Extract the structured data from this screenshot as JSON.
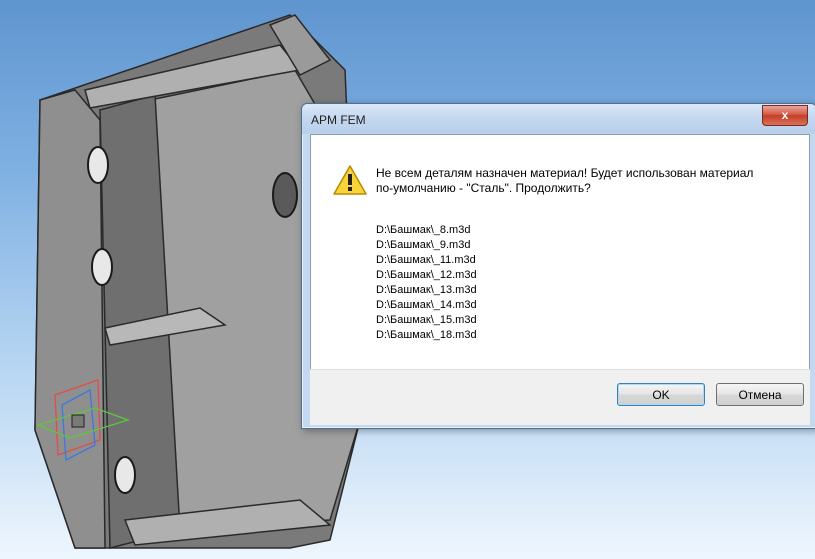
{
  "dialog": {
    "title": "APM FEM",
    "close_label": "x",
    "message_line1": "Не всем деталям назначен материал! Будет использован материал",
    "message_line2": "по-умолчанию - \"Сталь\". Продолжить?",
    "files": [
      "D:\\Башмак\\_8.m3d",
      "D:\\Башмак\\_9.m3d",
      "D:\\Башмак\\_11.m3d",
      "D:\\Башмак\\_12.m3d",
      "D:\\Башмак\\_13.m3d",
      "D:\\Башмак\\_14.m3d",
      "D:\\Башмак\\_15.m3d",
      "D:\\Башмак\\_18.m3d"
    ],
    "ok_label": "OK",
    "cancel_label": "Отмена",
    "icon": "warning-icon"
  },
  "colors": {
    "background_top": "#5f95cf",
    "part_gray": "#8a8a8a"
  }
}
